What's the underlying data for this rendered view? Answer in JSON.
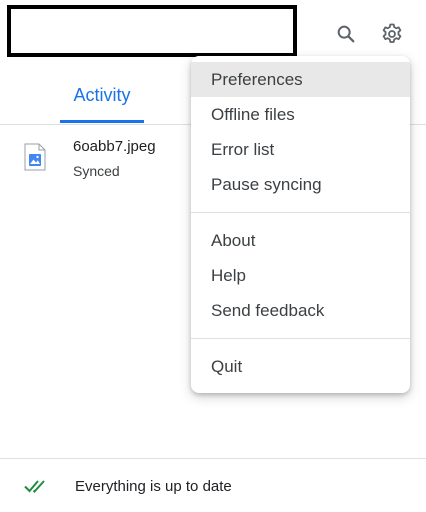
{
  "header": {
    "title": "",
    "icons": {
      "search": "search-icon",
      "settings": "gear-icon"
    }
  },
  "tabs": [
    {
      "label": "Activity",
      "selected": true
    }
  ],
  "activity": {
    "items": [
      {
        "file_name": "6oabb7.jpeg",
        "status": "Synced",
        "icon": "image-file-icon"
      }
    ]
  },
  "footer": {
    "status_text": "Everything is up to date",
    "icon": "double-check-icon"
  },
  "menu": {
    "groups": [
      [
        "Preferences",
        "Offline files",
        "Error list",
        "Pause syncing"
      ],
      [
        "About",
        "Help",
        "Send feedback"
      ],
      [
        "Quit"
      ]
    ],
    "highlighted": "Preferences"
  },
  "colors": {
    "accent": "#1a73e8",
    "check": "#1e8e3e",
    "menu_highlight": "#e8e8e8",
    "divider": "#e0e0e0"
  }
}
